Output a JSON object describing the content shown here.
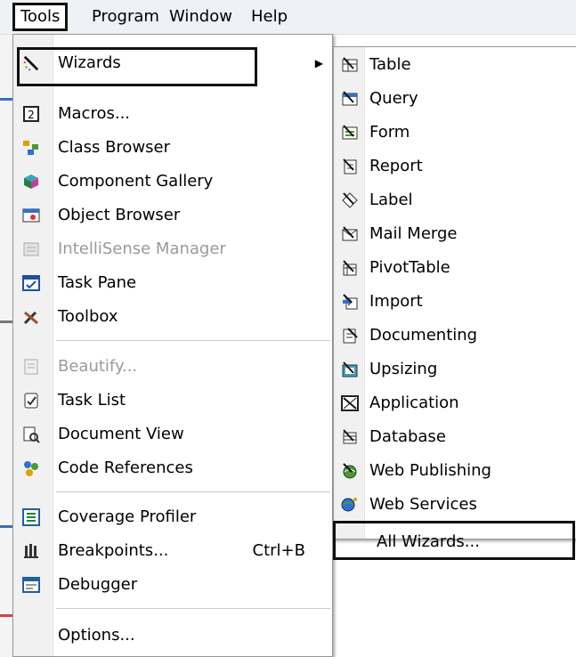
{
  "menubar": {
    "items": [
      {
        "label": "Tools"
      },
      {
        "label": "Program"
      },
      {
        "label": "Window"
      },
      {
        "label": "Help"
      }
    ]
  },
  "tools_menu": {
    "items": [
      {
        "label": "Wizards",
        "icon": "wizards-icon"
      },
      {
        "label": "Macros...",
        "icon": "macros-icon"
      },
      {
        "label": "Class Browser",
        "icon": "class-browser-icon"
      },
      {
        "label": "Component Gallery",
        "icon": "component-gallery-icon"
      },
      {
        "label": "Object Browser",
        "icon": "object-browser-icon"
      },
      {
        "label": "IntelliSense Manager",
        "icon": "intellisense-icon",
        "disabled": true
      },
      {
        "label": "Task Pane",
        "icon": "task-pane-icon"
      },
      {
        "label": "Toolbox",
        "icon": "toolbox-icon"
      },
      {
        "label": "Beautify...",
        "icon": "beautify-icon",
        "disabled": true
      },
      {
        "label": "Task List",
        "icon": "task-list-icon"
      },
      {
        "label": "Document View",
        "icon": "document-view-icon"
      },
      {
        "label": "Code References",
        "icon": "code-references-icon"
      },
      {
        "label": "Coverage Profiler",
        "icon": "coverage-profiler-icon"
      },
      {
        "label": "Breakpoints...",
        "icon": "breakpoints-icon",
        "shortcut": "Ctrl+B"
      },
      {
        "label": "Debugger",
        "icon": "debugger-icon"
      },
      {
        "label": "Options...",
        "icon": ""
      }
    ]
  },
  "wizards_submenu": {
    "items": [
      {
        "label": "Table",
        "icon": "table-wizard-icon"
      },
      {
        "label": "Query",
        "icon": "query-wizard-icon"
      },
      {
        "label": "Form",
        "icon": "form-wizard-icon"
      },
      {
        "label": "Report",
        "icon": "report-wizard-icon"
      },
      {
        "label": "Label",
        "icon": "label-wizard-icon"
      },
      {
        "label": "Mail Merge",
        "icon": "mail-merge-wizard-icon"
      },
      {
        "label": "PivotTable",
        "icon": "pivottable-wizard-icon"
      },
      {
        "label": "Import",
        "icon": "import-wizard-icon"
      },
      {
        "label": "Documenting",
        "icon": "documenting-wizard-icon"
      },
      {
        "label": "Upsizing",
        "icon": "upsizing-wizard-icon"
      },
      {
        "label": "Application",
        "icon": "application-wizard-icon"
      },
      {
        "label": "Database",
        "icon": "database-wizard-icon"
      },
      {
        "label": "Web Publishing",
        "icon": "web-publishing-wizard-icon"
      },
      {
        "label": "Web Services",
        "icon": "web-services-wizard-icon"
      },
      {
        "label": "All Wizards...",
        "icon": ""
      }
    ]
  }
}
